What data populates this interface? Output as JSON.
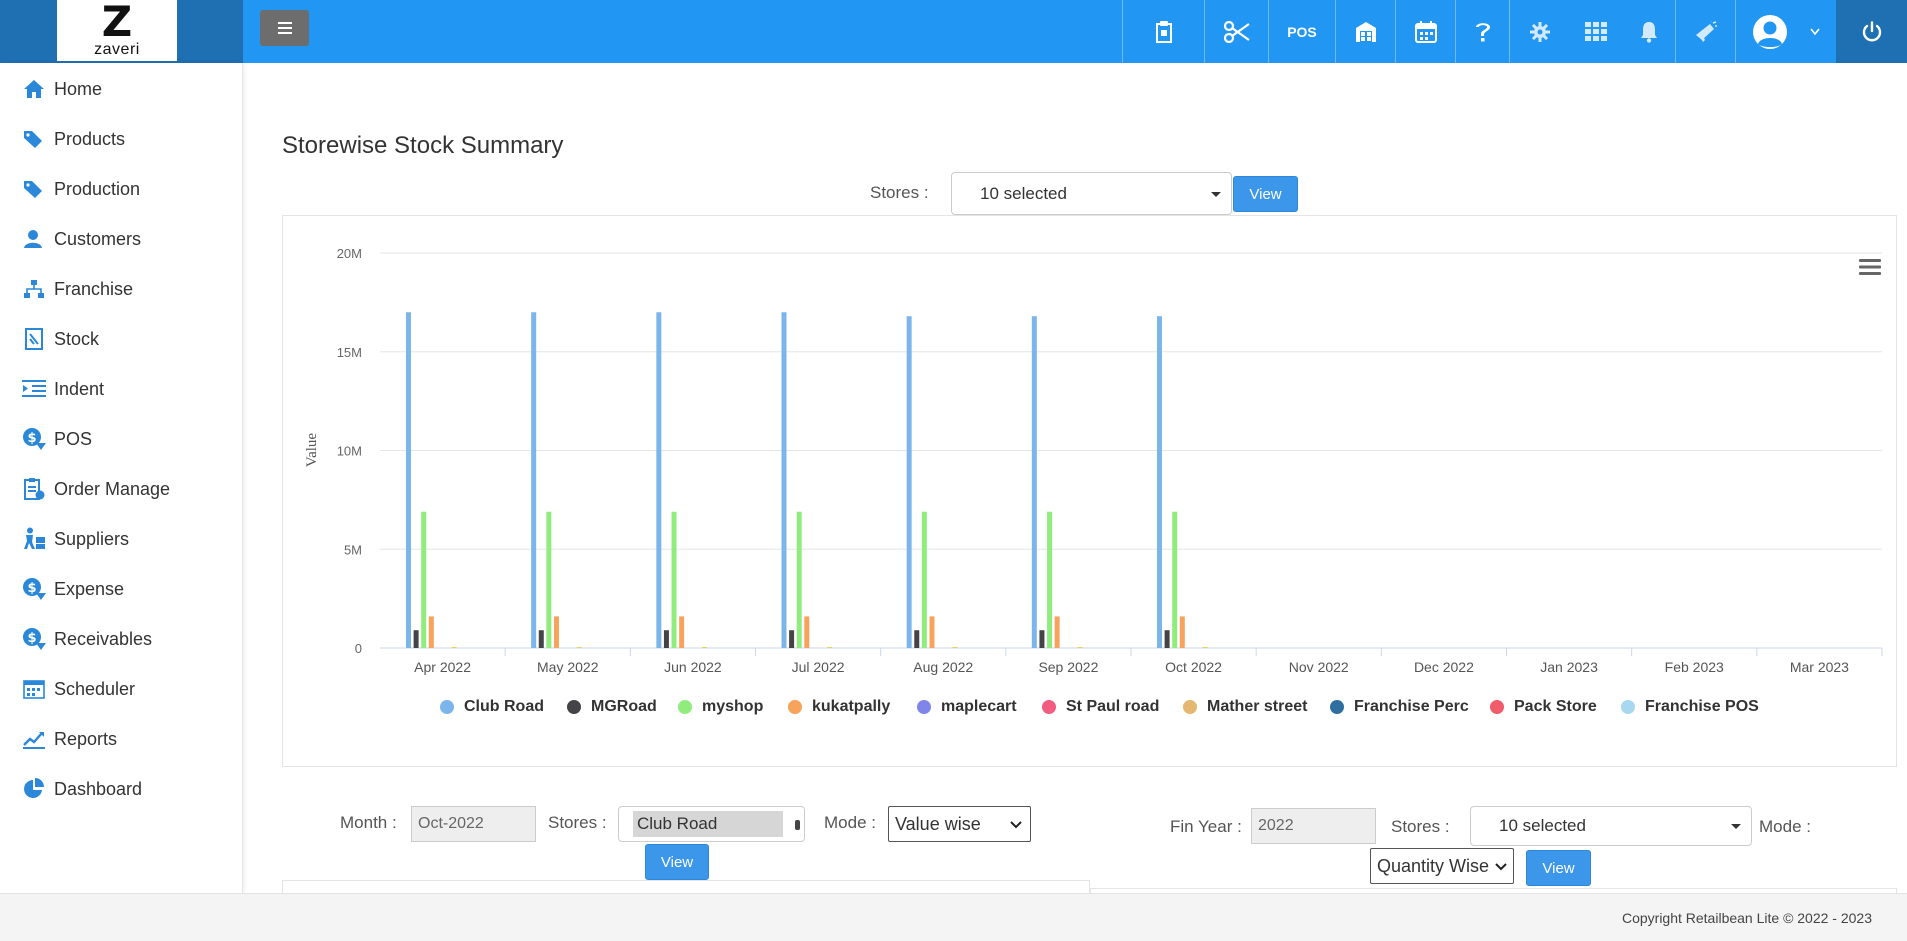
{
  "brand": {
    "logo_letter": "Z",
    "logo_name": "zaveri"
  },
  "topbar": {
    "menu_icon": "hamburger-icon",
    "icons": [
      "clipboard-icon",
      "scissors-icon",
      "pos-icon",
      "warehouse-icon",
      "calendar-icon",
      "help-icon",
      "gear-icon",
      "apps-grid-icon",
      "bell-icon",
      "megaphone-icon",
      "user-avatar-icon",
      "power-icon"
    ],
    "pos_label": "POS"
  },
  "sidebar": {
    "items": [
      {
        "label": "Home",
        "icon": "home-icon"
      },
      {
        "label": "Products",
        "icon": "tags-icon"
      },
      {
        "label": "Production",
        "icon": "tags-icon"
      },
      {
        "label": "Customers",
        "icon": "user-icon"
      },
      {
        "label": "Franchise",
        "icon": "sitemap-icon"
      },
      {
        "label": "Stock",
        "icon": "stock-icon"
      },
      {
        "label": "Indent",
        "icon": "indent-icon"
      },
      {
        "label": "POS",
        "icon": "dollar-icon"
      },
      {
        "label": "Order Manage",
        "icon": "order-icon"
      },
      {
        "label": "Suppliers",
        "icon": "supplier-icon"
      },
      {
        "label": "Expense",
        "icon": "dollar-icon"
      },
      {
        "label": "Receivables",
        "icon": "dollar-icon"
      },
      {
        "label": "Scheduler",
        "icon": "scheduler-icon"
      },
      {
        "label": "Reports",
        "icon": "chart-line-icon"
      },
      {
        "label": "Dashboard",
        "icon": "pie-chart-icon"
      }
    ]
  },
  "main": {
    "title": "Storewise Stock Summary",
    "top_filter": {
      "stores_label": "Stores :",
      "stores_value": "10 selected",
      "view_label": "View"
    }
  },
  "chart_data": {
    "type": "bar",
    "title": "",
    "ylabel": "Value",
    "xlabel": "",
    "ylim": [
      0,
      20000000
    ],
    "yticks": [
      "0",
      "5M",
      "10M",
      "15M",
      "20M"
    ],
    "ytick_values": [
      0,
      5000000,
      10000000,
      15000000,
      20000000
    ],
    "grid": true,
    "legend_position": "bottom",
    "categories": [
      "Apr 2022",
      "May 2022",
      "Jun 2022",
      "Jul 2022",
      "Aug 2022",
      "Sep 2022",
      "Oct 2022",
      "Nov 2022",
      "Dec 2022",
      "Jan 2023",
      "Feb 2023",
      "Mar 2023"
    ],
    "series": [
      {
        "name": "Club Road",
        "color": "#7cb5ec",
        "values": [
          17000000,
          17000000,
          17000000,
          17000000,
          16800000,
          16800000,
          16800000,
          0,
          0,
          0,
          0,
          0
        ]
      },
      {
        "name": "MGRoad",
        "color": "#434348",
        "values": [
          900000,
          900000,
          900000,
          900000,
          900000,
          900000,
          900000,
          0,
          0,
          0,
          0,
          0
        ]
      },
      {
        "name": "myshop",
        "color": "#90ed7d",
        "values": [
          6900000,
          6900000,
          6900000,
          6900000,
          6900000,
          6900000,
          6900000,
          0,
          0,
          0,
          0,
          0
        ]
      },
      {
        "name": "kukatpally",
        "color": "#f7a35c",
        "values": [
          1600000,
          1600000,
          1600000,
          1600000,
          1600000,
          1600000,
          1600000,
          0,
          0,
          0,
          0,
          0
        ]
      },
      {
        "name": "maplecart",
        "color": "#8085e9",
        "values": [
          0,
          0,
          0,
          0,
          0,
          0,
          0,
          0,
          0,
          0,
          0,
          0
        ]
      },
      {
        "name": "St Paul road",
        "color": "#f15c80",
        "values": [
          0,
          0,
          0,
          0,
          0,
          0,
          0,
          0,
          0,
          0,
          0,
          0
        ]
      },
      {
        "name": "Mather street",
        "color": "#e4d354",
        "values": [
          50000,
          50000,
          50000,
          50000,
          50000,
          50000,
          50000,
          0,
          0,
          0,
          0,
          0
        ]
      },
      {
        "name": "Franchise Perc",
        "color": "#2b908f",
        "values": [
          0,
          0,
          0,
          0,
          0,
          0,
          0,
          0,
          0,
          0,
          0,
          0
        ]
      },
      {
        "name": "Pack Store",
        "color": "#f45b5b",
        "values": [
          0,
          0,
          0,
          0,
          0,
          0,
          0,
          0,
          0,
          0,
          0,
          0
        ]
      },
      {
        "name": "Franchise POS",
        "color": "#91e8e1",
        "values": [
          0,
          0,
          0,
          0,
          0,
          0,
          0,
          0,
          0,
          0,
          0,
          0
        ]
      }
    ],
    "legend_colors": [
      "#7cb5ec",
      "#434348",
      "#90ed7d",
      "#f7a35c",
      "#8085e9",
      "#f15c80",
      "#e4b870",
      "#2f6f9f",
      "#f15c6a",
      "#a8d8f0"
    ]
  },
  "bottom_filters": {
    "left": {
      "month_label": "Month :",
      "month_value": "Oct-2022",
      "stores_label": "Stores :",
      "stores_value": "Club Road",
      "mode_label": "Mode :",
      "mode_value": "Value wise",
      "view_label": "View"
    },
    "right": {
      "finyear_label": "Fin Year :",
      "finyear_value": "2022",
      "stores_label": "Stores :",
      "stores_value": "10 selected",
      "mode_label": "Mode :",
      "mode_value": "Quantity Wise",
      "view_label": "View"
    }
  },
  "footer": {
    "copyright": "Copyright Retailbean Lite © 2022 - 2023"
  }
}
